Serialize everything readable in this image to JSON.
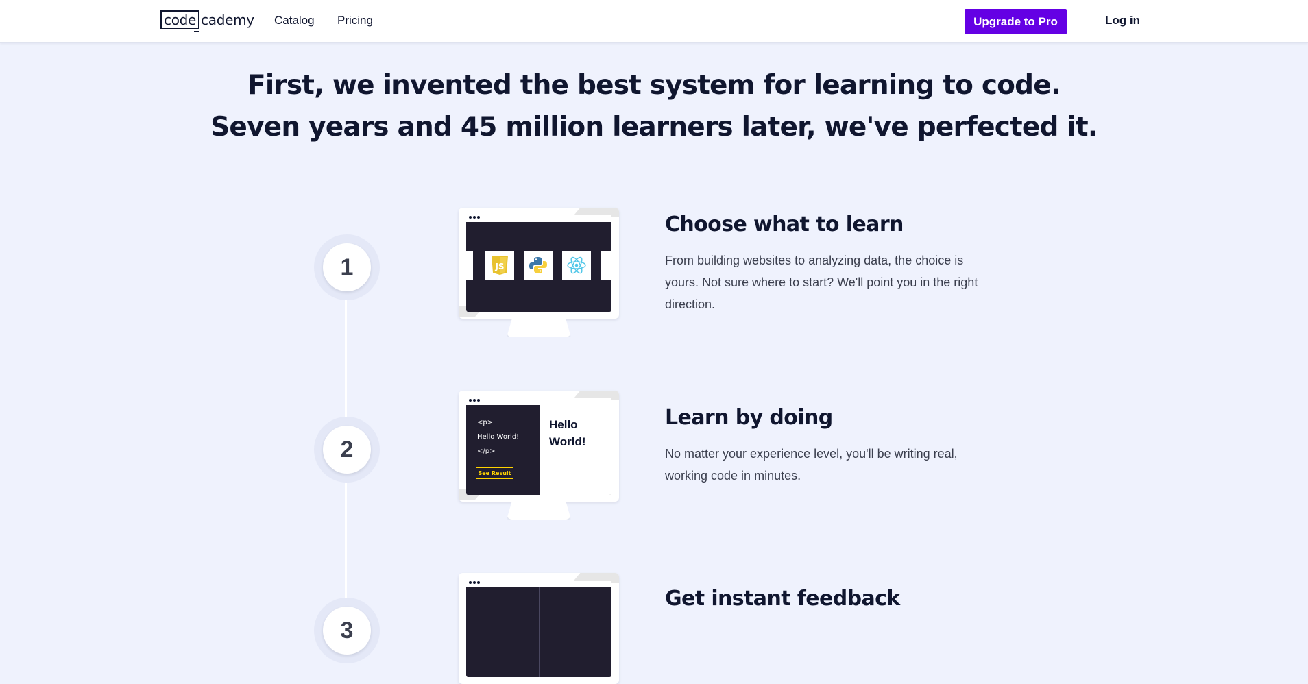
{
  "nav": {
    "logo": {
      "boxed": "code",
      "rest": "cademy"
    },
    "links": [
      "Catalog",
      "Pricing"
    ],
    "upgrade_label": "Upgrade to Pro",
    "login_label": "Log in"
  },
  "hero": {
    "line1": "First, we invented the best system for learning to code.",
    "line2": "Seven years and 45 million learners later, we've perfected it."
  },
  "steps": [
    {
      "number": "1",
      "title": "Choose what to learn",
      "description": "From building websites to analyzing data, the choice is yours. Not sure where to start? We'll point you in the right direction.",
      "screen_icons": [
        "javascript-icon",
        "python-icon",
        "react-icon"
      ]
    },
    {
      "number": "2",
      "title": "Learn by doing",
      "description": "No matter your experience level, you'll be writing real, working code in minutes.",
      "code_lines": [
        "<p>",
        "Hello World!",
        "</p>"
      ],
      "see_result_label": "See Result",
      "result_text": "Hello World!"
    },
    {
      "number": "3",
      "title": "Get instant feedback"
    }
  ],
  "colors": {
    "page_bg": "#eff2fd",
    "brand_purple": "#6400e4",
    "navy": "#10162f",
    "screen_dark": "#211e2f",
    "see_result_yellow": "#ffd300"
  }
}
